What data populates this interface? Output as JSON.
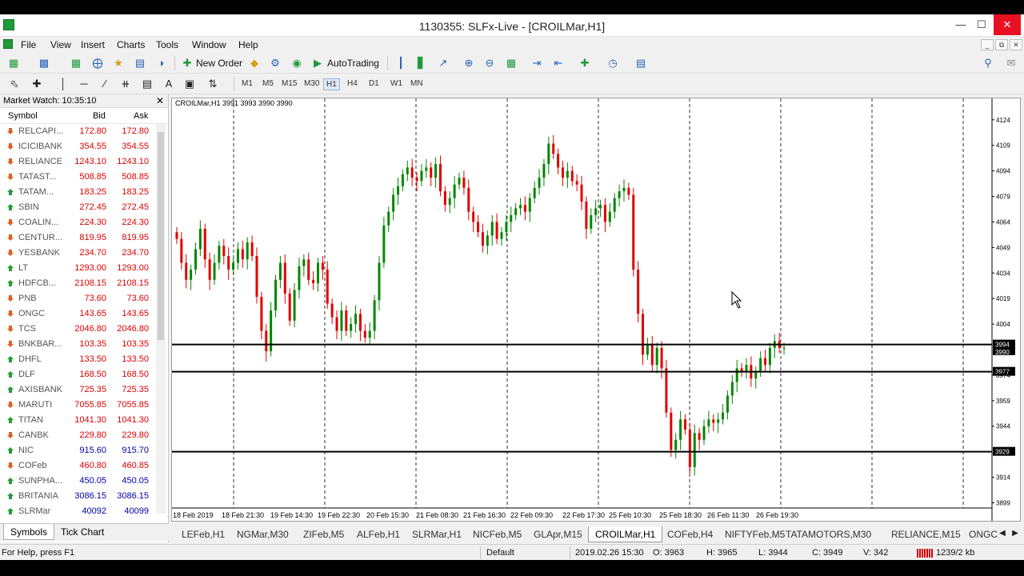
{
  "window": {
    "title": "1130355: SLFx-Live - [CROILMar,H1]"
  },
  "menu": [
    "File",
    "View",
    "Insert",
    "Charts",
    "Tools",
    "Window",
    "Help"
  ],
  "toolbar": {
    "new_order": "New Order",
    "autotrading": "AutoTrading",
    "timeframes": [
      "M1",
      "M5",
      "M15",
      "M30",
      "H1",
      "H4",
      "D1",
      "W1",
      "MN"
    ],
    "active_timeframe": "H1"
  },
  "market_watch": {
    "title": "Market Watch: 10:35:10",
    "columns": {
      "symbol": "Symbol",
      "bid": "Bid",
      "ask": "Ask"
    },
    "rows": [
      {
        "symbol": "RELCAPI...",
        "bid": "172.80",
        "ask": "172.80",
        "dir": "down"
      },
      {
        "symbol": "ICICIBANK",
        "bid": "354.55",
        "ask": "354.55",
        "dir": "down"
      },
      {
        "symbol": "RELIANCE",
        "bid": "1243.10",
        "ask": "1243.10",
        "dir": "down"
      },
      {
        "symbol": "TATAST...",
        "bid": "508.85",
        "ask": "508.85",
        "dir": "down"
      },
      {
        "symbol": "TATAM...",
        "bid": "183.25",
        "ask": "183.25",
        "dir": "up"
      },
      {
        "symbol": "SBIN",
        "bid": "272.45",
        "ask": "272.45",
        "dir": "up"
      },
      {
        "symbol": "COALIN...",
        "bid": "224.30",
        "ask": "224.30",
        "dir": "down"
      },
      {
        "symbol": "CENTUR...",
        "bid": "819.95",
        "ask": "819.95",
        "dir": "down"
      },
      {
        "symbol": "YESBANK",
        "bid": "234.70",
        "ask": "234.70",
        "dir": "down"
      },
      {
        "symbol": "LT",
        "bid": "1293.00",
        "ask": "1293.00",
        "dir": "up"
      },
      {
        "symbol": "HDFCB...",
        "bid": "2108.15",
        "ask": "2108.15",
        "dir": "up"
      },
      {
        "symbol": "PNB",
        "bid": "73.60",
        "ask": "73.60",
        "dir": "down"
      },
      {
        "symbol": "ONGC",
        "bid": "143.65",
        "ask": "143.65",
        "dir": "down"
      },
      {
        "symbol": "TCS",
        "bid": "2046.80",
        "ask": "2046.80",
        "dir": "down"
      },
      {
        "symbol": "BNKBAR...",
        "bid": "103.35",
        "ask": "103.35",
        "dir": "down"
      },
      {
        "symbol": "DHFL",
        "bid": "133.50",
        "ask": "133.50",
        "dir": "up"
      },
      {
        "symbol": "DLF",
        "bid": "168.50",
        "ask": "168.50",
        "dir": "up"
      },
      {
        "symbol": "AXISBANK",
        "bid": "725.35",
        "ask": "725.35",
        "dir": "up"
      },
      {
        "symbol": "MARUTI",
        "bid": "7055.85",
        "ask": "7055.85",
        "dir": "down"
      },
      {
        "symbol": "TITAN",
        "bid": "1041.30",
        "ask": "1041.30",
        "dir": "up"
      },
      {
        "symbol": "CANBK",
        "bid": "229.80",
        "ask": "229.80",
        "dir": "down"
      },
      {
        "symbol": "NIC",
        "bid": "915.60",
        "ask": "915.70",
        "dir": "up",
        "blue": true
      },
      {
        "symbol": "COFeb",
        "bid": "460.80",
        "ask": "460.85",
        "dir": "down"
      },
      {
        "symbol": "SUNPHA...",
        "bid": "450.05",
        "ask": "450.05",
        "dir": "up",
        "blue": true
      },
      {
        "symbol": "BRITANIA",
        "bid": "3086.15",
        "ask": "3086.15",
        "dir": "up",
        "blue": true
      },
      {
        "symbol": "SLRMar",
        "bid": "40092",
        "ask": "40099",
        "dir": "up",
        "blue": true
      }
    ],
    "tabs": [
      "Symbols",
      "Tick Chart"
    ]
  },
  "chart": {
    "header": "CROILMar,H1  3991 3993 3990 3990",
    "price_labels": [
      "4124",
      "4109",
      "4094",
      "4079",
      "4064",
      "4049",
      "4034",
      "4019",
      "4004",
      "3974",
      "3959",
      "3944",
      "3914",
      "3899"
    ],
    "time_labels": [
      "18 Feb 2019",
      "18 Feb 21:30",
      "19 Feb 14:30",
      "19 Feb 22:30",
      "20 Feb 15:30",
      "21 Feb 08:30",
      "21 Feb 16:30",
      "22 Feb 09:30",
      "22 Feb 17:30",
      "25 Feb 10:30",
      "25 Feb 18:30",
      "26 Feb 11:30",
      "26 Feb 19:30"
    ],
    "hlines": [
      {
        "price": 3992,
        "label": "3994"
      },
      {
        "price": 3976,
        "label": "3977"
      },
      {
        "price": 3929,
        "label": "3929"
      }
    ],
    "bid_label": "3990",
    "colors": {
      "up": "#008800",
      "down": "#e00000",
      "grid": "#000000"
    }
  },
  "chart_data": {
    "type": "candlestick",
    "ylim": [
      3895,
      4130
    ],
    "close_series": [
      4054,
      4040,
      4030,
      4036,
      4048,
      4060,
      4042,
      4030,
      4040,
      4050,
      4044,
      4036,
      4040,
      4048,
      4042,
      4052,
      4044,
      4020,
      4000,
      3988,
      4012,
      4030,
      4040,
      4022,
      4006,
      4024,
      4038,
      4042,
      4030,
      4028,
      4040,
      4036,
      4016,
      4008,
      4000,
      4012,
      4000,
      4004,
      4010,
      4000,
      3996,
      4000,
      4018,
      4040,
      4062,
      4070,
      4080,
      4085,
      4092,
      4096,
      4090,
      4088,
      4094,
      4096,
      4090,
      4098,
      4082,
      4074,
      4078,
      4086,
      4090,
      4084,
      4070,
      4064,
      4058,
      4050,
      4056,
      4064,
      4054,
      4058,
      4064,
      4068,
      4072,
      4074,
      4070,
      4078,
      4084,
      4090,
      4098,
      4110,
      4104,
      4096,
      4090,
      4094,
      4088,
      4086,
      4076,
      4060,
      4068,
      4072,
      4074,
      4064,
      4070,
      4078,
      4082,
      4084,
      4080,
      4036,
      4010,
      3986,
      3992,
      3980,
      3990,
      3978,
      3952,
      3930,
      3936,
      3948,
      3942,
      3920,
      3940,
      3936,
      3944,
      3948,
      3946,
      3948,
      3952,
      3962,
      3970,
      3978,
      3976,
      3980,
      3972,
      3976,
      3984,
      3980,
      3990,
      3994,
      3990,
      3990
    ],
    "dates": [
      "18 Feb 2019",
      "18 Feb 21:30",
      "19 Feb 14:30",
      "19 Feb 22:30",
      "20 Feb 15:30",
      "21 Feb 08:30",
      "21 Feb 16:30",
      "22 Feb 09:30",
      "22 Feb 17:30",
      "25 Feb 10:30",
      "25 Feb 18:30",
      "26 Feb 11:30",
      "26 Feb 19:30"
    ]
  },
  "chart_tabs": [
    "LEFeb,H1",
    "NGMar,M30",
    "ZIFeb,M5",
    "ALFeb,H1",
    "SLRMar,H1",
    "NICFeb,M5",
    "GLApr,M15",
    "CROILMar,H1",
    "COFeb,H4",
    "NIFTYFeb,M5",
    "TATAMOTORS,M30",
    "RELIANCE,M15",
    "ONGC"
  ],
  "active_chart_tab": "CROILMar,H1",
  "status": {
    "help": "For Help, press F1",
    "profile": "Default",
    "time": "2019.02.26 15:30",
    "open": "O: 3963",
    "high": "H: 3965",
    "low": "L: 3944",
    "close": "C: 3949",
    "volume": "V: 342",
    "traffic": "1239/2 kb"
  }
}
